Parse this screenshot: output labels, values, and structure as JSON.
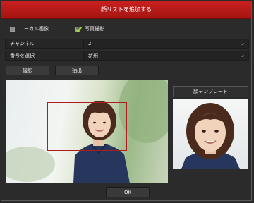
{
  "dialog": {
    "title": "顔リストを追加する",
    "close_symbol": "✕"
  },
  "source_options": {
    "local_image_label": "ローカル画像",
    "local_image_checked": false,
    "photo_capture_label": "写真撮影",
    "photo_capture_checked": true
  },
  "fields": {
    "channel_label": "チャンネル",
    "channel_value": "2",
    "number_label": "番号を選択",
    "number_value": "新規"
  },
  "buttons": {
    "capture_label": "撮影",
    "extract_label": "抽出",
    "ok_label": "OK"
  },
  "template_panel": {
    "label": "顔テンプレート"
  },
  "colors": {
    "title_bar": "#c8201f",
    "checkbox_check": "#a8e040",
    "selection_box": "#b01b1b"
  }
}
